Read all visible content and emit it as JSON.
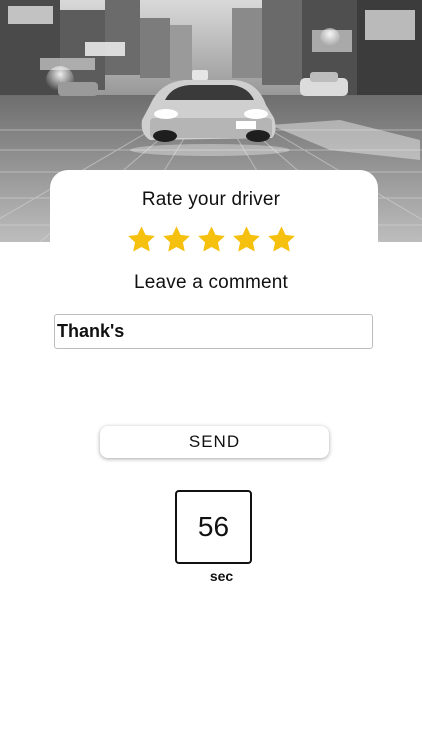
{
  "rating": {
    "title": "Rate your driver",
    "stars_total": 5,
    "stars_selected": 5,
    "star_color": "#F6C00E"
  },
  "comment": {
    "label": "Leave a comment",
    "value": "Thank's"
  },
  "send_button": {
    "label": "SEND"
  },
  "timer": {
    "value": "56",
    "unit": "sec"
  },
  "hero": {
    "icon": "taxi-city-night-illustration"
  }
}
